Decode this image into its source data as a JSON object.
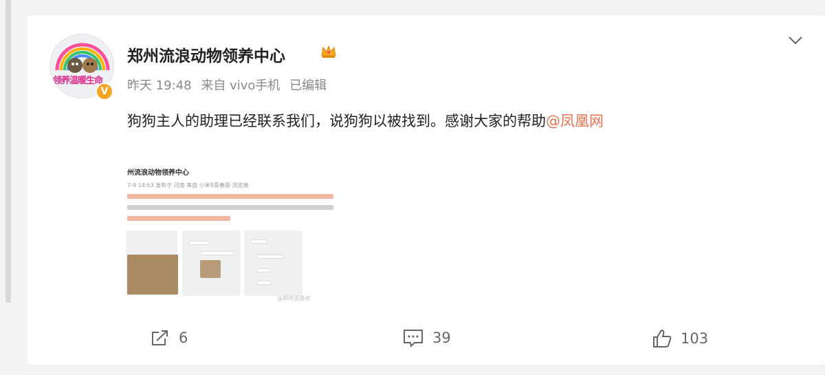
{
  "post": {
    "username": "郑州流浪动物领养中心",
    "avatar_text": "领养温暖生命",
    "verified_mark": "V",
    "time": "昨天 19:48",
    "source": "来自 vivo手机",
    "edited": "已编辑",
    "text": "狗狗主人的助理已经联系我们，说狗狗以被找到。感谢大家的帮助",
    "mention": "@凤凰网",
    "thumbnail": {
      "header": "州流浪动物领养中心",
      "meta": "7-9 14:53 发布于 河南 来自 小米8青春版 浏览微",
      "watermark": "@郑州流浪动"
    }
  },
  "actions": {
    "repost_count": "6",
    "comment_count": "39",
    "like_count": "103"
  },
  "icons": [
    "crown-icon",
    "chevron-down-icon",
    "repost-icon",
    "comment-icon",
    "like-icon"
  ],
  "colors": {
    "accent": "#eb7350",
    "verified": "#f6a623",
    "background": "#f2f3f5"
  }
}
